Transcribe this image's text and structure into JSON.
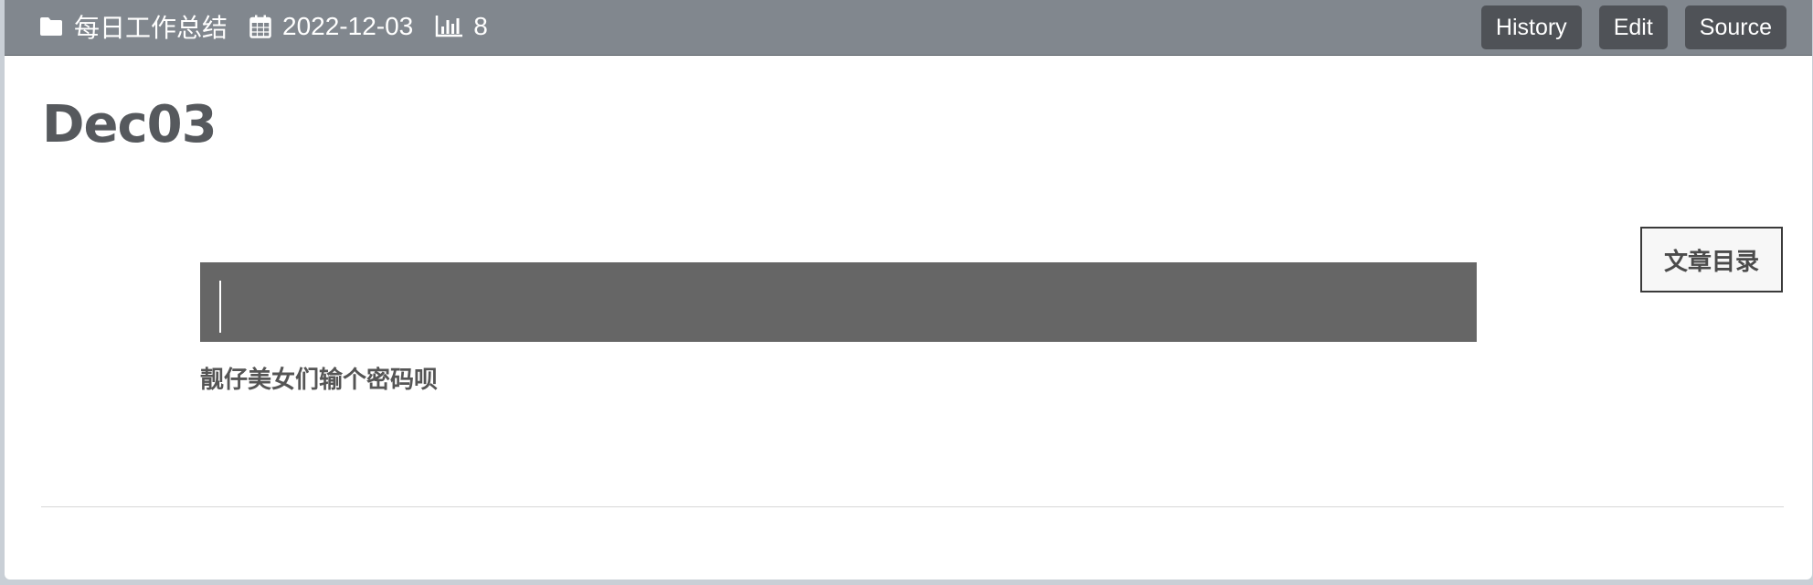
{
  "header": {
    "category": "每日工作总结",
    "date": "2022-12-03",
    "views": "8",
    "icons": {
      "category": "folder-icon",
      "date": "calendar-icon",
      "views": "bar-chart-icon"
    },
    "actions": {
      "history_label": "History",
      "edit_label": "Edit",
      "source_label": "Source"
    }
  },
  "post": {
    "title": "Dec03",
    "toc_label": "文章目录",
    "password_hint": "靓仔美女们输个密码呗",
    "password_value": ""
  },
  "colors": {
    "header_bg": "#81878e",
    "button_bg": "#4f5257",
    "password_box_bg": "#666666",
    "title_text": "#56595d"
  }
}
